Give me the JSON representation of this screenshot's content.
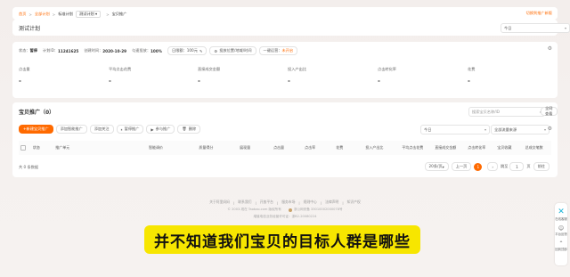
{
  "breadcrumb": {
    "items": [
      "首页",
      "全部计划",
      "标准计划",
      "测试计划",
      "宝贝推广"
    ],
    "right_link": "切换到推广新版"
  },
  "plan": {
    "title": "测试计划",
    "select": "今日"
  },
  "status": {
    "label": "状态：",
    "value": "暂停",
    "plan_id_label": "计划ID：",
    "plan_id": "11241625",
    "date_label": "创建时间：",
    "date": "2020-10-29",
    "smooth_label": "匀速投放：",
    "smooth": "100%",
    "budget_label": "日限额：",
    "budget": "100元",
    "btn_area": "投放位置/地域/时间",
    "btn_optimize": "一键运营：",
    "optimize_state": "未开启"
  },
  "metrics": [
    {
      "label": "点击量",
      "value": "-"
    },
    {
      "label": "平均点击花费",
      "value": "-"
    },
    {
      "label": "直接成交金额",
      "value": "-"
    },
    {
      "label": "投入产出比",
      "value": "-"
    },
    {
      "label": "点击转化率",
      "value": "-"
    },
    {
      "label": "花费",
      "value": "-"
    }
  ],
  "product": {
    "title": "宝贝推广（0）",
    "search_placeholder": "搜索宝贝名称/ID",
    "btn_all": "全网查看",
    "actions": [
      "+新建宝贝推广",
      "添加智能推广",
      "添加关注",
      "暂停推广",
      "参与推广",
      "删除"
    ],
    "select_day": "今日",
    "select_filter": "全部流量来源"
  },
  "table": {
    "headers": [
      "状态",
      "推广单元",
      "智能调价",
      "质量得分",
      "展现量",
      "点击量",
      "点击率",
      "花费",
      "投入产出比",
      "平均点击花费",
      "直接成交金额",
      "点击转化率",
      "宝贝收藏",
      "总成交笔数"
    ]
  },
  "pagination": {
    "total": "共 0 条数据",
    "page_size": "20条/页",
    "prev": "上一页",
    "current": "1",
    "label": "跳至",
    "page_input": "1",
    "unit": "页",
    "go": "前往"
  },
  "footer": {
    "links": [
      "关于阿里妈妈",
      "联系我们",
      "开放平台",
      "服务市场",
      "规则中心",
      "法律声明",
      "知识产权"
    ],
    "copyright": "© 2003-现在 Taobao.com 版权所有",
    "icp": "浙公网安备 33010002000078号",
    "license": "增值电信业务经营许可证：浙B2-20080224"
  },
  "subtitle": "并不知道我们宝贝的目标人群是哪些",
  "sidebar": {
    "items": [
      "在线客服",
      "平台反馈",
      "回到顶部"
    ]
  }
}
